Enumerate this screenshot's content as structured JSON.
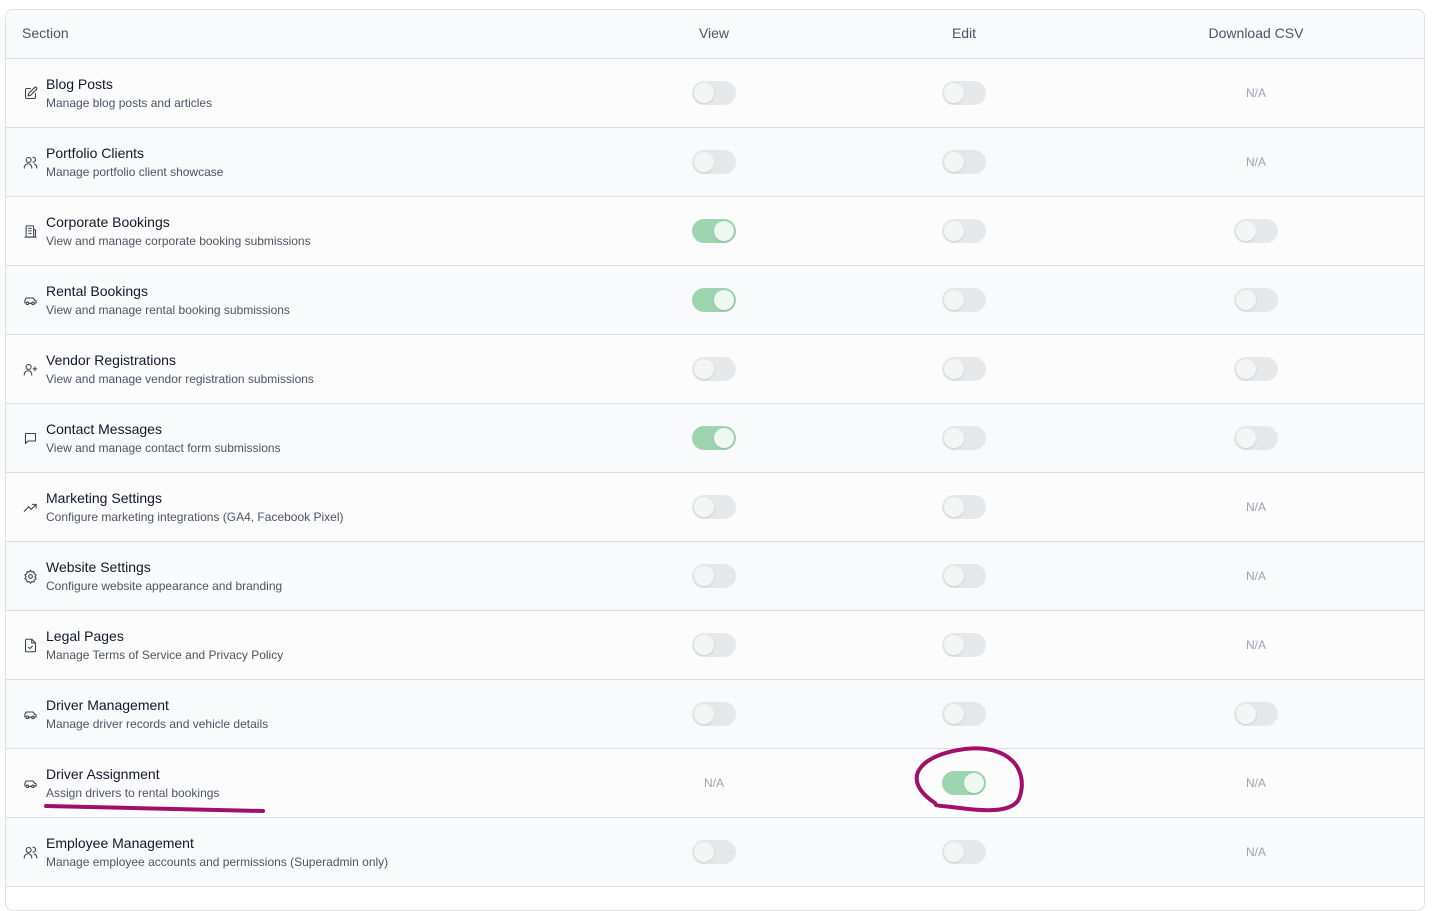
{
  "columns": {
    "section": "Section",
    "view": "View",
    "edit": "Edit",
    "download_csv": "Download CSV"
  },
  "na_label": "N/A",
  "accent_on": "#98d3ad",
  "annotation_color": "#a0106a",
  "rows": [
    {
      "icon": "pencil-square-icon",
      "title": "Blog Posts",
      "desc": "Manage blog posts and articles",
      "view": false,
      "edit": false,
      "csv": null
    },
    {
      "icon": "users-icon",
      "title": "Portfolio Clients",
      "desc": "Manage portfolio client showcase",
      "view": false,
      "edit": false,
      "csv": null
    },
    {
      "icon": "building-icon",
      "title": "Corporate Bookings",
      "desc": "View and manage corporate booking submissions",
      "view": true,
      "edit": false,
      "csv": false
    },
    {
      "icon": "car-icon",
      "title": "Rental Bookings",
      "desc": "View and manage rental booking submissions",
      "view": true,
      "edit": false,
      "csv": false
    },
    {
      "icon": "user-plus-icon",
      "title": "Vendor Registrations",
      "desc": "View and manage vendor registration submissions",
      "view": false,
      "edit": false,
      "csv": false
    },
    {
      "icon": "message-icon",
      "title": "Contact Messages",
      "desc": "View and manage contact form submissions",
      "view": true,
      "edit": false,
      "csv": false
    },
    {
      "icon": "trending-up-icon",
      "title": "Marketing Settings",
      "desc": "Configure marketing integrations (GA4, Facebook Pixel)",
      "view": false,
      "edit": false,
      "csv": null
    },
    {
      "icon": "gear-icon",
      "title": "Website Settings",
      "desc": "Configure website appearance and branding",
      "view": false,
      "edit": false,
      "csv": null
    },
    {
      "icon": "file-check-icon",
      "title": "Legal Pages",
      "desc": "Manage Terms of Service and Privacy Policy",
      "view": false,
      "edit": false,
      "csv": null
    },
    {
      "icon": "car-icon",
      "title": "Driver Management",
      "desc": "Manage driver records and vehicle details",
      "view": false,
      "edit": false,
      "csv": false
    },
    {
      "icon": "car-icon",
      "title": "Driver Assignment",
      "desc": "Assign drivers to rental bookings",
      "view": null,
      "edit": true,
      "csv": null
    },
    {
      "icon": "users-icon",
      "title": "Employee Management",
      "desc": "Manage employee accounts and permissions (Superadmin only)",
      "view": false,
      "edit": false,
      "csv": null
    }
  ]
}
